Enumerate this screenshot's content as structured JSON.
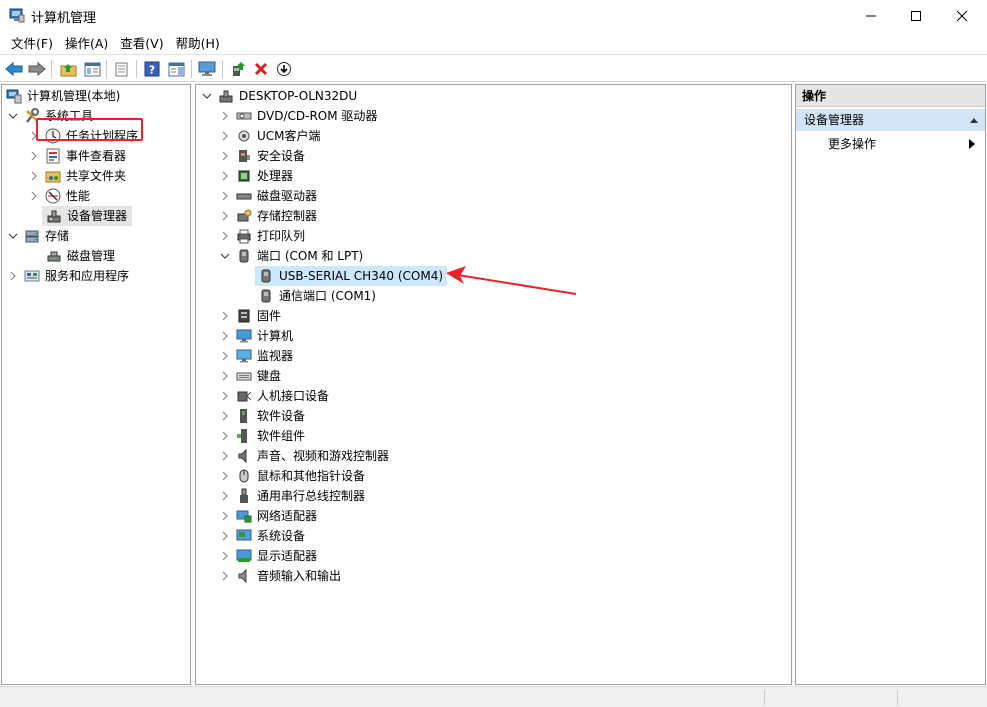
{
  "window": {
    "title": "计算机管理"
  },
  "menu": [
    {
      "id": "file",
      "label": "文件(F)"
    },
    {
      "id": "action",
      "label": "操作(A)"
    },
    {
      "id": "view",
      "label": "查看(V)"
    },
    {
      "id": "help",
      "label": "帮助(H)"
    }
  ],
  "toolbar": {
    "icons": [
      "back-icon",
      "forward-icon",
      "up-folder-icon",
      "show-hide-tree-icon",
      "export-list-icon",
      "help-icon",
      "action-pane-icon",
      "monitor-icon",
      "update-driver-icon",
      "uninstall-icon",
      "scan-download-icon"
    ]
  },
  "left_tree": {
    "root": "计算机管理(本地)",
    "system_tools": "系统工具",
    "task_scheduler": "任务计划程序",
    "event_viewer": "事件查看器",
    "shared_folders": "共享文件夹",
    "performance": "性能",
    "device_manager": "设备管理器",
    "storage": "存储",
    "disk_management": "磁盘管理",
    "services_apps": "服务和应用程序"
  },
  "device_tree": {
    "computer": "DESKTOP-OLN32DU",
    "categories": [
      {
        "label": "DVD/CD-ROM 驱动器",
        "icon": "dvd-drive-icon"
      },
      {
        "label": "UCM客户端",
        "icon": "ucm-client-icon"
      },
      {
        "label": "安全设备",
        "icon": "security-device-icon"
      },
      {
        "label": "处理器",
        "icon": "processor-icon"
      },
      {
        "label": "磁盘驱动器",
        "icon": "disk-drive-icon"
      },
      {
        "label": "存储控制器",
        "icon": "storage-controller-icon"
      },
      {
        "label": "打印队列",
        "icon": "print-queue-icon"
      },
      {
        "label": "端口 (COM 和 LPT)",
        "icon": "port-icon"
      },
      {
        "label": "固件",
        "icon": "firmware-icon"
      },
      {
        "label": "计算机",
        "icon": "computer-icon"
      },
      {
        "label": "监视器",
        "icon": "monitor-icon"
      },
      {
        "label": "键盘",
        "icon": "keyboard-icon"
      },
      {
        "label": "人机接口设备",
        "icon": "hid-icon"
      },
      {
        "label": "软件设备",
        "icon": "software-device-icon"
      },
      {
        "label": "软件组件",
        "icon": "software-component-icon"
      },
      {
        "label": "声音、视频和游戏控制器",
        "icon": "sound-icon"
      },
      {
        "label": "鼠标和其他指针设备",
        "icon": "mouse-icon"
      },
      {
        "label": "通用串行总线控制器",
        "icon": "usb-icon"
      },
      {
        "label": "网络适配器",
        "icon": "network-adapter-icon"
      },
      {
        "label": "系统设备",
        "icon": "system-device-icon"
      },
      {
        "label": "显示适配器",
        "icon": "display-adapter-icon"
      },
      {
        "label": "音频输入和输出",
        "icon": "audio-io-icon"
      }
    ],
    "ports_children": [
      {
        "label": "USB-SERIAL CH340 (COM4)"
      },
      {
        "label": "通信端口 (COM1)"
      }
    ]
  },
  "actions_pane": {
    "header": "操作",
    "section": "设备管理器",
    "more": "更多操作"
  },
  "colors": {
    "annotation_red": "#e8232b",
    "selection_blue": "#cce8ff",
    "section_blue": "#d2e4f5"
  }
}
